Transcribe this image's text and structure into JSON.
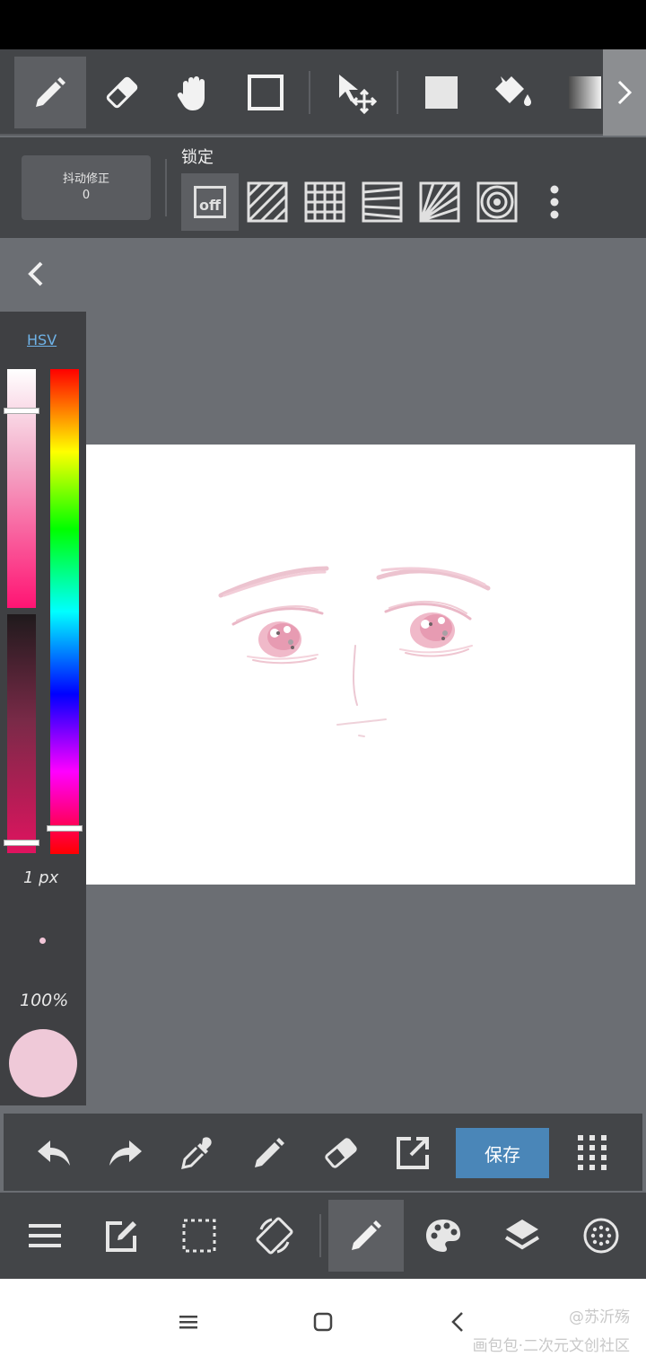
{
  "top_toolbar": {
    "tools": [
      "pen-icon",
      "eraser-icon",
      "hand-icon",
      "rectangle-icon",
      "move-icon",
      "fill-square-icon",
      "bucket-icon",
      "gradient-icon"
    ],
    "more_icon": "chevron-right-icon"
  },
  "ruler_bar": {
    "stabilizer_label": "抖动修正",
    "stabilizer_value": "0",
    "lock_label": "锁定",
    "off_label": "off"
  },
  "color_panel": {
    "mode_label": "HSV",
    "brush_size": "1 px",
    "opacity": "100%",
    "current_color": "#efc9d8"
  },
  "action_bar": {
    "save_label": "保存"
  },
  "watermark": {
    "line1": "@苏沂殇",
    "line2": "画包包·二次元文创社区"
  },
  "colors": {
    "toolbar_bg": "#434548",
    "accent": "#4a86b8",
    "workspace_bg": "#6b6e73"
  }
}
